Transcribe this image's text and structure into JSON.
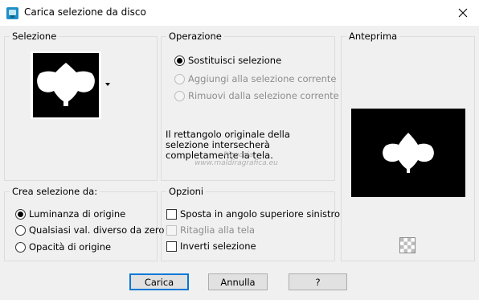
{
  "window": {
    "title": "Carica selezione da disco"
  },
  "selection_group": {
    "label": "Selezione"
  },
  "operation_group": {
    "label": "Operazione",
    "options": [
      {
        "label": "Sostituisci selezione",
        "checked": true,
        "enabled": true
      },
      {
        "label": "Aggiungi alla selezione corrente",
        "checked": false,
        "enabled": false
      },
      {
        "label": "Rimuovi dalla selezione corrente",
        "checked": false,
        "enabled": false
      }
    ],
    "info_text": "Il rettangolo originale della selezione intersecherà completamente la tela."
  },
  "preview_group": {
    "label": "Anteprima"
  },
  "create_group": {
    "label": "Crea selezione da:",
    "options": [
      {
        "label": "Luminanza di origine",
        "checked": true
      },
      {
        "label": "Qualsiasi val. diverso da zero",
        "checked": false
      },
      {
        "label": "Opacità di origine",
        "checked": false
      }
    ]
  },
  "options_group": {
    "label": "Opzioni",
    "options": [
      {
        "label": "Sposta in angolo superiore sinistro",
        "checked": false,
        "enabled": true
      },
      {
        "label": "Ritaglia alla tela",
        "checked": false,
        "enabled": false
      },
      {
        "label": "Inverti selezione",
        "checked": false,
        "enabled": true
      }
    ]
  },
  "buttons": {
    "load": "Carica",
    "cancel": "Annulla",
    "help": "?"
  },
  "watermark": {
    "line1": "Pinuccia",
    "line2": "www.maldiragrafica.eu"
  },
  "colors": {
    "accent": "#0078d7",
    "app_icon": "#1e8fc8",
    "background": "#f0f0f0"
  }
}
